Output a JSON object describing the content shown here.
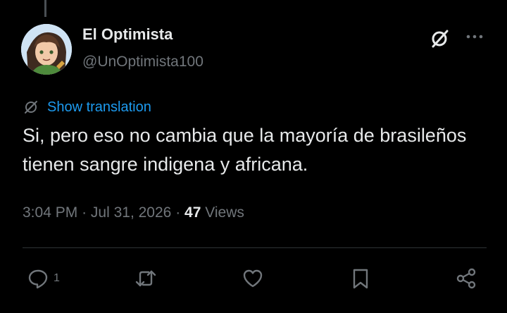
{
  "post": {
    "author": {
      "display_name": "El Optimista",
      "handle": "@UnOptimista100"
    },
    "translate_label": "Show translation",
    "text": "Si, pero eso no cambia que la mayoría de brasileños tienen sangre indigena y africana.",
    "time": "3:04 PM",
    "date": "Jul 31, 2026",
    "separator": "·",
    "views_count": "47",
    "views_label": "Views",
    "replies_count": "1"
  },
  "icons": {
    "header": [
      "grok-icon",
      "more-icon"
    ],
    "actions": [
      "reply-icon",
      "repost-icon",
      "like-icon",
      "bookmark-icon",
      "share-icon"
    ]
  },
  "colors": {
    "background": "#000000",
    "primary_text": "#e7e9ea",
    "secondary_text": "#71767b",
    "link": "#1d9bf0",
    "divider": "#2f3336"
  }
}
